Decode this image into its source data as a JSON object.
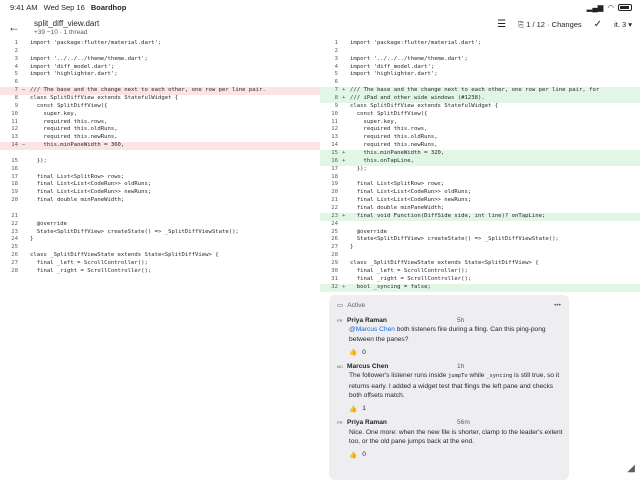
{
  "status_bar": {
    "time": "9:41 AM",
    "date": "Wed Sep 16",
    "app": "Boardhop"
  },
  "header": {
    "file_name": "split_diff_view.dart",
    "stats": "+39 −10 · 1 thread",
    "change_counter": "1 / 12 · Changes",
    "more_label": "it. 3 ▾"
  },
  "left_lines": [
    {
      "n": "1",
      "t": "",
      "c": "import 'package:flutter/material.dart';"
    },
    {
      "n": "2",
      "t": "",
      "c": ""
    },
    {
      "n": "3",
      "t": "",
      "c": "import '../../../theme/theme.dart';"
    },
    {
      "n": "4",
      "t": "",
      "c": "import 'diff_model.dart';"
    },
    {
      "n": "5",
      "t": "",
      "c": "import 'highlighter.dart';"
    },
    {
      "n": "6",
      "t": "",
      "c": ""
    },
    {
      "n": "7",
      "t": "del",
      "m": "−",
      "c": "/// The base and the change next to each other, one row per line pair."
    },
    {
      "n": "8",
      "t": "",
      "c": "class SplitDiffView extends StatefulWidget {"
    },
    {
      "n": "9",
      "t": "",
      "c": "  const SplitDiffView({"
    },
    {
      "n": "10",
      "t": "",
      "c": "    super.key,"
    },
    {
      "n": "11",
      "t": "",
      "c": "    required this.rows,"
    },
    {
      "n": "12",
      "t": "",
      "c": "    required this.oldRuns,"
    },
    {
      "n": "13",
      "t": "",
      "c": "    required this.newRuns,"
    },
    {
      "n": "14",
      "t": "del",
      "m": "−",
      "c": "    this.minPaneWidth = 360,"
    },
    {
      "n": "",
      "t": "blank",
      "c": ""
    },
    {
      "n": "15",
      "t": "",
      "c": "  });"
    },
    {
      "n": "16",
      "t": "",
      "c": ""
    },
    {
      "n": "17",
      "t": "",
      "c": "  final List<SplitRow> rows;"
    },
    {
      "n": "18",
      "t": "",
      "c": "  final List<List<CodeRun>> oldRuns;"
    },
    {
      "n": "19",
      "t": "",
      "c": "  final List<List<CodeRun>> newRuns;"
    },
    {
      "n": "20",
      "t": "",
      "c": "  final double minPaneWidth;"
    },
    {
      "n": "",
      "t": "blank",
      "c": ""
    },
    {
      "n": "21",
      "t": "",
      "c": ""
    },
    {
      "n": "22",
      "t": "",
      "c": "  @override"
    },
    {
      "n": "23",
      "t": "",
      "c": "  State<SplitDiffView> createState() => _SplitDiffViewState();"
    },
    {
      "n": "24",
      "t": "",
      "c": "}"
    },
    {
      "n": "25",
      "t": "",
      "c": ""
    },
    {
      "n": "26",
      "t": "",
      "c": "class _SplitDiffViewState extends State<SplitDiffView> {"
    },
    {
      "n": "27",
      "t": "",
      "c": "  final _left = ScrollController();"
    },
    {
      "n": "28",
      "t": "",
      "c": "  final _right = ScrollController();"
    }
  ],
  "right_lines": [
    {
      "n": "1",
      "t": "",
      "c": "import 'package:flutter/material.dart';"
    },
    {
      "n": "2",
      "t": "",
      "c": ""
    },
    {
      "n": "3",
      "t": "",
      "c": "import '../../../theme/theme.dart';"
    },
    {
      "n": "4",
      "t": "",
      "c": "import 'diff_model.dart';"
    },
    {
      "n": "5",
      "t": "",
      "c": "import 'highlighter.dart';"
    },
    {
      "n": "6",
      "t": "",
      "c": ""
    },
    {
      "n": "7",
      "t": "add",
      "m": "+",
      "c": "/// The base and the change next to each other, one row per line pair, for"
    },
    {
      "n": "8",
      "t": "add",
      "m": "+",
      "c": "/// iPad and other wide windows (#1238)."
    },
    {
      "n": "9",
      "t": "",
      "c": "class SplitDiffView extends StatefulWidget {"
    },
    {
      "n": "10",
      "t": "",
      "c": "  const SplitDiffView({"
    },
    {
      "n": "11",
      "t": "",
      "c": "    super.key,"
    },
    {
      "n": "12",
      "t": "",
      "c": "    required this.rows,"
    },
    {
      "n": "13",
      "t": "",
      "c": "    required this.oldRuns,"
    },
    {
      "n": "14",
      "t": "",
      "c": "    required this.newRuns,"
    },
    {
      "n": "15",
      "t": "add",
      "m": "+",
      "c": "    this.minPaneWidth = 320,"
    },
    {
      "n": "16",
      "t": "add",
      "m": "+",
      "c": "    this.onTapLine,"
    },
    {
      "n": "17",
      "t": "",
      "c": "  });"
    },
    {
      "n": "18",
      "t": "",
      "c": ""
    },
    {
      "n": "19",
      "t": "",
      "c": "  final List<SplitRow> rows;"
    },
    {
      "n": "20",
      "t": "",
      "c": "  final List<List<CodeRun>> oldRuns;"
    },
    {
      "n": "21",
      "t": "",
      "c": "  final List<List<CodeRun>> newRuns;"
    },
    {
      "n": "22",
      "t": "",
      "c": "  final double minPaneWidth;"
    },
    {
      "n": "23",
      "t": "add",
      "m": "+",
      "c": "  final void Function(DiffSide side, int line)? onTapLine;"
    },
    {
      "n": "24",
      "t": "",
      "c": ""
    },
    {
      "n": "25",
      "t": "",
      "c": "  @override"
    },
    {
      "n": "26",
      "t": "",
      "c": "  State<SplitDiffView> createState() => _SplitDiffViewState();"
    },
    {
      "n": "27",
      "t": "",
      "c": "}"
    },
    {
      "n": "28",
      "t": "",
      "c": ""
    },
    {
      "n": "29",
      "t": "",
      "c": "class _SplitDiffViewState extends State<SplitDiffView> {"
    },
    {
      "n": "30",
      "t": "",
      "c": "  final _left = ScrollController();"
    },
    {
      "n": "31",
      "t": "",
      "c": "  final _right = ScrollController();"
    },
    {
      "n": "32",
      "t": "add",
      "m": "+",
      "c": "  bool _syncing = false;"
    }
  ],
  "thread": {
    "status": "Active",
    "comments": [
      {
        "initials": "PR",
        "author": "Priya Raman",
        "time": "5h",
        "mention": "@Marcus Chen",
        "body": " both listeners fire during a fling. Can this ping-pong between the panes?",
        "reactions": "0"
      },
      {
        "initials": "MC",
        "author": "Marcus Chen",
        "time": "1h",
        "body_a": "The follower's listener runs inside ",
        "code_a": "jumpTo",
        "body_b": " while ",
        "code_b": "_syncing",
        "body_c": " is still true, so it returns early. I added a widget test that flings the left pane and checks both offsets match.",
        "reactions": "1"
      },
      {
        "initials": "PR",
        "author": "Priya Raman",
        "time": "56m",
        "body": "Nice. One more: when the new file is shorter, clamp to the leader's extent too, or the old pane jumps back at the end.",
        "reactions": "0"
      }
    ]
  },
  "colors": {
    "deletion": "#fde4e4",
    "addition": "#e2f6e6",
    "keyword": "#cf222e",
    "type": "#8250df",
    "string": "#0a3069",
    "comment": "#6e7781"
  }
}
